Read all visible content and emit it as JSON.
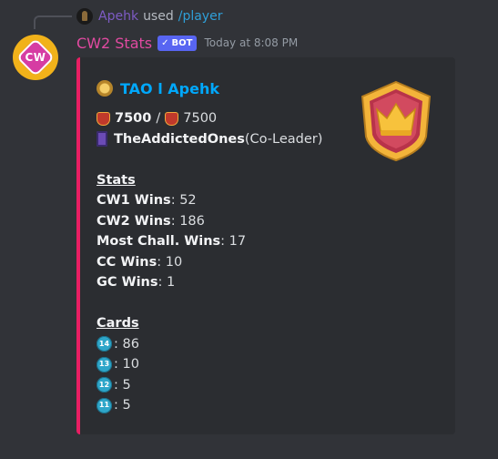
{
  "reply": {
    "user": "Apehk",
    "action": "used",
    "command": "/player"
  },
  "message": {
    "avatar_text": "CW",
    "bot_name": "CW2 Stats",
    "bot_tag": "BOT",
    "bot_tag_check": "✓",
    "timestamp": "Today at 8:08 PM"
  },
  "embed": {
    "accent_color": "#e91e63",
    "title": "TAO l Apehk",
    "trophies_current": "7500",
    "trophy_separator": "/",
    "trophies_best": "7500",
    "clan_name": "TheAddictedOnes",
    "clan_role": "(Co-Leader)",
    "stats_heading": "Stats",
    "stats": [
      {
        "label": "CW1 Wins",
        "value": "52"
      },
      {
        "label": "CW2 Wins",
        "value": "186"
      },
      {
        "label": "Most Chall. Wins",
        "value": "17"
      },
      {
        "label": "CC Wins",
        "value": "10"
      },
      {
        "label": "GC Wins",
        "value": "1"
      }
    ],
    "cards_heading": "Cards",
    "cards": [
      {
        "level": "14",
        "count": "86"
      },
      {
        "level": "13",
        "count": "10"
      },
      {
        "level": "12",
        "count": "5"
      },
      {
        "level": "11",
        "count": "5"
      }
    ],
    "icons": {
      "title": "gold-badge-icon",
      "trophy": "trophy-icon",
      "clan": "clan-badge-icon",
      "thumbnail": "crown-shield-icon"
    }
  }
}
